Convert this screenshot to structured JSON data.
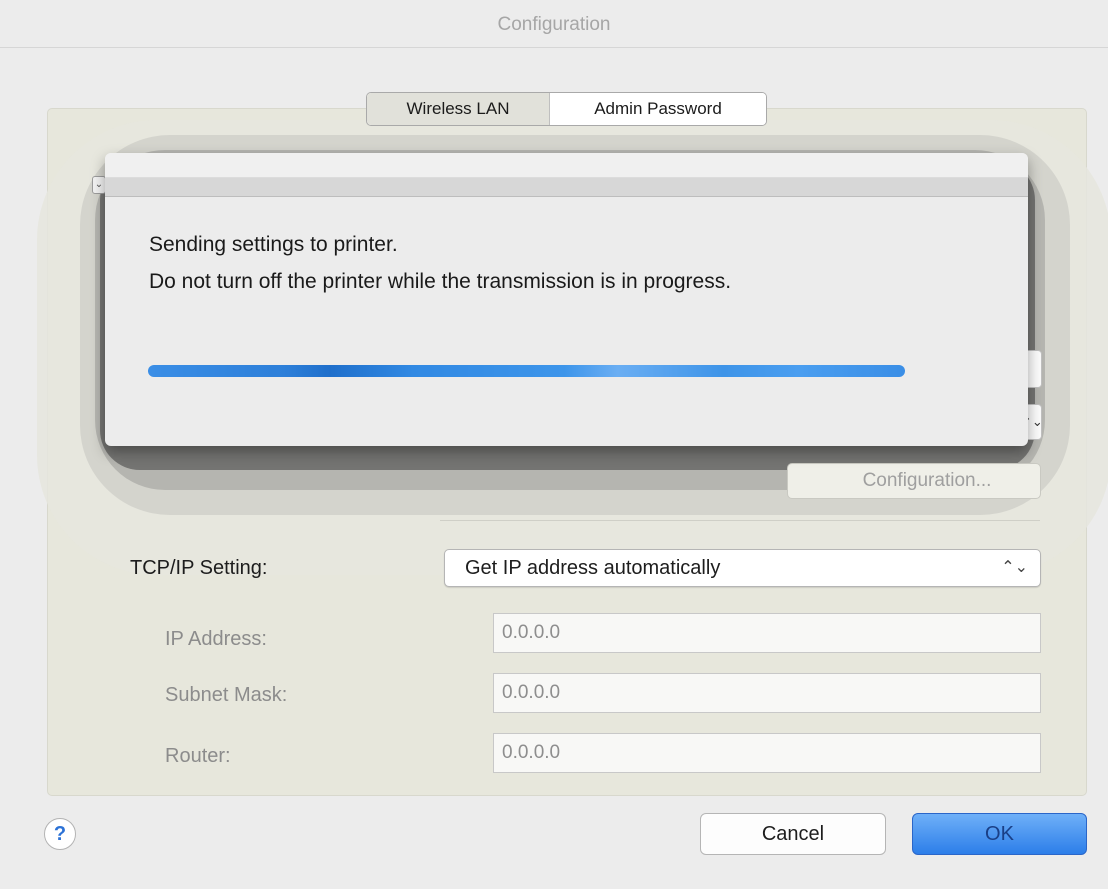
{
  "window": {
    "title": "Configuration"
  },
  "tabs": [
    {
      "label": "Wireless LAN",
      "selected": true
    },
    {
      "label": "Admin Password",
      "selected": false
    }
  ],
  "background_controls": {
    "configuration_button_label": "Configuration...",
    "stepper_glyph": "⌃⌄"
  },
  "sheet": {
    "message_line1": "Sending settings to printer.",
    "message_line2": "Do not turn off the printer while the transmission is in progress."
  },
  "tcpip": {
    "label": "TCP/IP Setting:",
    "selected_option": "Get IP address automatically",
    "ip_label": "IP Address:",
    "ip_value": "0.0.0.0",
    "subnet_label": "Subnet Mask:",
    "subnet_value": "0.0.0.0",
    "router_label": "Router:",
    "router_value": "0.0.0.0"
  },
  "footer": {
    "help_glyph": "?",
    "cancel_label": "Cancel",
    "ok_label": "OK"
  },
  "colors": {
    "accent_blue": "#2c7ee9",
    "panel_bg": "#e7e7dc"
  },
  "icons": [
    "help-icon",
    "stepper-arrows-icon",
    "chevron-down-icon"
  ]
}
